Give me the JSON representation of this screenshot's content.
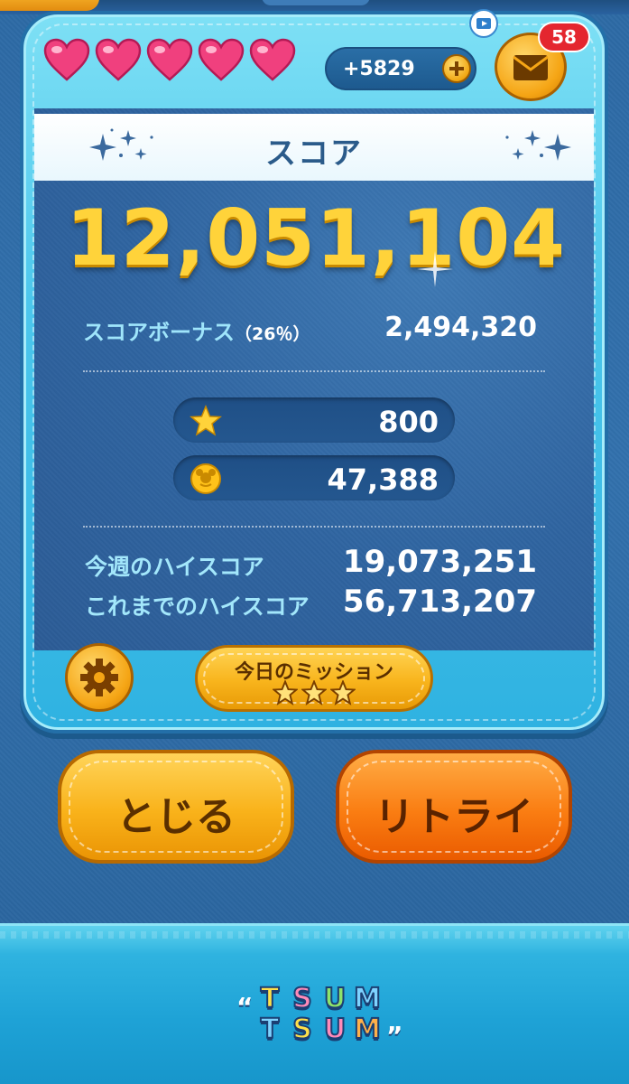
{
  "header": {
    "hearts_count": 5,
    "coin_balance": "+5829",
    "mail_badge": "58",
    "icons": [
      "heart-icon",
      "plus-icon",
      "mail-icon",
      "video-icon"
    ]
  },
  "score_panel": {
    "title": "スコア",
    "score": "12,051,104",
    "bonus_label": "スコアボーナス",
    "bonus_percent": "（26％）",
    "bonus_value": "2,494,320",
    "exp_value": "800",
    "coins_value": "47,388",
    "weekly_high_label": "今週のハイスコア",
    "weekly_high_value": "19,073,251",
    "all_time_high_label": "これまでのハイスコア",
    "all_time_high_value": "56,713,207"
  },
  "footer_panel": {
    "mission_label": "今日のミッション",
    "mission_stars": 3
  },
  "actions": {
    "close_label": "とじる",
    "retry_label": "リトライ"
  },
  "logo": {
    "row1": [
      "T",
      "S",
      "U",
      "M"
    ],
    "row2": [
      "T",
      "S",
      "U",
      "M"
    ]
  },
  "colors": {
    "gold": "#ffd33a",
    "panel_cyan": "#4cc7ec",
    "inner_navy": "#2f64a0",
    "label_cyan": "#a3e7fb",
    "badge_red": "#e4262f"
  }
}
